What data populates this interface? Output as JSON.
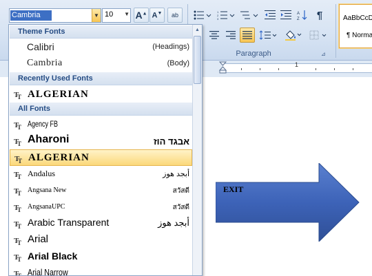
{
  "ribbon": {
    "font_name": "Cambria",
    "font_size": "10",
    "grow_font": "A",
    "shrink_font": "A",
    "clear_format": "ab",
    "style_sample_1": "AaBbCcDc",
    "style_sample_2": "¶ Normal",
    "group_label": "Paragraph",
    "pilcrow": "¶"
  },
  "ruler": {
    "number": "1"
  },
  "font_list": {
    "theme_header": "Theme Fonts",
    "theme_fonts": [
      {
        "name": "Calibri",
        "tag": "(Headings)"
      },
      {
        "name": "Cambria",
        "tag": "(Body)"
      }
    ],
    "recent_header": "Recently Used Fonts",
    "recent_fonts": [
      {
        "name": "ALGERIAN"
      }
    ],
    "all_header": "All Fonts",
    "all_fonts": [
      {
        "name": "Agency FB",
        "sample": ""
      },
      {
        "name": "Aharoni",
        "sample": "אבגד הוז"
      },
      {
        "name": "ALGERIAN",
        "sample": ""
      },
      {
        "name": "Andalus",
        "sample": "أبجد هوز"
      },
      {
        "name": "Angsana New",
        "sample": "สวัสดี"
      },
      {
        "name": "AngsanaUPC",
        "sample": "สวัสดี"
      },
      {
        "name": "Arabic Transparent",
        "sample": "أبجد هوز"
      },
      {
        "name": "Arial",
        "sample": ""
      },
      {
        "name": "Arial Black",
        "sample": ""
      },
      {
        "name": "Arial Narrow",
        "sample": ""
      }
    ]
  },
  "document": {
    "shape_text": "EXIT"
  },
  "colors": {
    "selection": "#fbd87a",
    "arrow": "#3d63b8"
  }
}
